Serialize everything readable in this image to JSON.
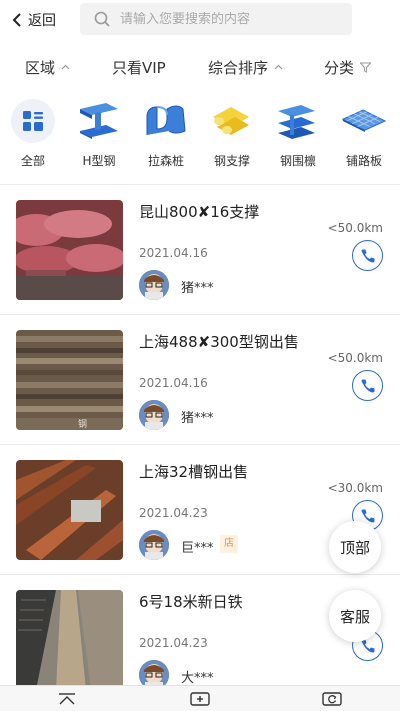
{
  "topbar": {
    "back_label": "返回",
    "search_placeholder": "请输入您要搜索的内容"
  },
  "filters": [
    {
      "label": "区域"
    },
    {
      "label": "只看VIP"
    },
    {
      "label": "综合排序"
    },
    {
      "label": "分类"
    }
  ],
  "categories": [
    {
      "label": "全部",
      "icon": "grid-icon"
    },
    {
      "label": "H型钢",
      "icon": "h-beam-icon"
    },
    {
      "label": "拉森桩",
      "icon": "sheet-pile-icon"
    },
    {
      "label": "钢支撑",
      "icon": "steel-pipe-icon"
    },
    {
      "label": "钢围檩",
      "icon": "steel-purlin-icon"
    },
    {
      "label": "铺路板",
      "icon": "road-plate-icon"
    }
  ],
  "listings": [
    {
      "title": "昆山800✘16支撑",
      "date": "2021.04.16",
      "user": "猪***",
      "distance": "<50.0km",
      "shop_badge": ""
    },
    {
      "title": "上海488✘300型钢出售",
      "date": "2021.04.16",
      "user": "猪***",
      "distance": "<50.0km",
      "shop_badge": ""
    },
    {
      "title": "上海32槽钢出售",
      "date": "2021.04.23",
      "user": "巨***",
      "distance": "<30.0km",
      "shop_badge": "店"
    },
    {
      "title": "6号18米新日铁",
      "date": "2021.04.23",
      "user": "大***",
      "distance": "",
      "shop_badge": ""
    }
  ],
  "floating": {
    "top_label": "顶部",
    "service_label": "客服"
  },
  "colors": {
    "accent": "#2a6bd1",
    "shop_badge": "#e8952f"
  }
}
